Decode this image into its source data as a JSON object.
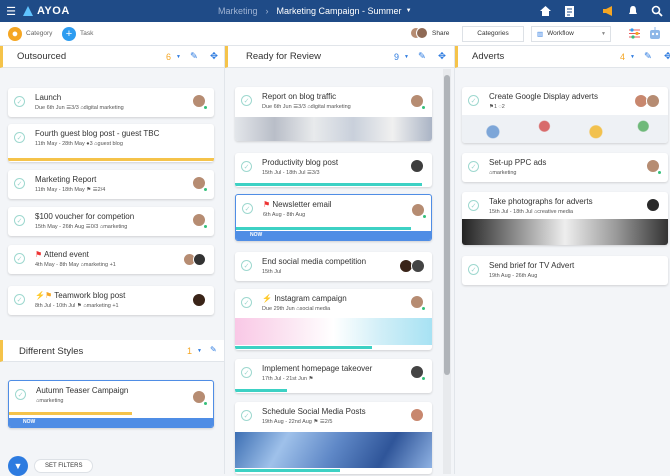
{
  "app": {
    "name": "AYOA"
  },
  "breadcrumb": {
    "parent": "Marketing",
    "current": "Marketing Campaign - Summer"
  },
  "toolbar": {
    "category": "Category",
    "task": "Task",
    "share": "Share",
    "categories": "Categories",
    "view": "Workflow"
  },
  "columns": [
    {
      "title": "Outsourced",
      "count": "6",
      "cards": [
        {
          "title": "Launch",
          "meta": "Due 6th Jun",
          "sub": "3/3",
          "tag": "digital marketing"
        },
        {
          "title": "Fourth guest blog post - guest TBC",
          "meta": "11th May - 28th May",
          "sub": "3",
          "tag": "guest blog"
        },
        {
          "title": "Marketing Report",
          "meta": "11th May - 18th May",
          "sub": "2/4",
          "tag": ""
        },
        {
          "title": "$100 voucher for competion",
          "meta": "15th May - 26th Aug",
          "sub": "0/3",
          "tag": "marketing"
        },
        {
          "title": "Attend event",
          "meta": "4th May - 8th May",
          "sub": "",
          "tag": "marketing +1"
        },
        {
          "title": "Teamwork blog post",
          "meta": "8th Jul - 10th Jul",
          "sub": "",
          "tag": "marketing +1"
        }
      ]
    },
    {
      "title": "Ready for Review",
      "count": "9",
      "cards": [
        {
          "title": "Report on blog traffic",
          "meta": "Due 6th Jun",
          "sub": "3/3",
          "tag": "digital marketing"
        },
        {
          "title": "Productivity blog post",
          "meta": "15th Jul - 18th Jul",
          "sub": "3/3",
          "tag": ""
        },
        {
          "title": "Newsletter email",
          "meta": "6th Aug - 8th Aug",
          "sub": "",
          "tag": ""
        },
        {
          "title": "End social media competition",
          "meta": "15th Jul",
          "sub": "",
          "tag": ""
        },
        {
          "title": "Instagram campaign",
          "meta": "Due 29th Jun",
          "sub": "",
          "tag": "social media"
        },
        {
          "title": "Implement homepage takeover",
          "meta": "17th Jul - 21st Jun",
          "sub": "",
          "tag": ""
        },
        {
          "title": "Schedule Social Media Posts",
          "meta": "19th Aug - 22nd Aug",
          "sub": "2/5",
          "tag": ""
        }
      ]
    },
    {
      "title": "Adverts",
      "count": "4",
      "cards": [
        {
          "title": "Create Google Display adverts",
          "meta": "",
          "sub": "1",
          "sub2": "2",
          "tag": ""
        },
        {
          "title": "Set-up PPC ads",
          "meta": "",
          "sub": "",
          "tag": "marketing"
        },
        {
          "title": "Take photographs for adverts",
          "meta": "15th Jul - 18th Jul",
          "sub": "",
          "tag": "creative media"
        },
        {
          "title": "Send brief for TV Advert",
          "meta": "19th Aug - 26th Aug",
          "sub": "",
          "tag": ""
        }
      ]
    }
  ],
  "group2": {
    "title": "Different Styles",
    "count": "1",
    "card": {
      "title": "Autumn Teaser Campaign",
      "tag": "marketing"
    }
  },
  "badge": {
    "now": "NOW"
  },
  "filters": {
    "label": "SET FILTERS"
  }
}
